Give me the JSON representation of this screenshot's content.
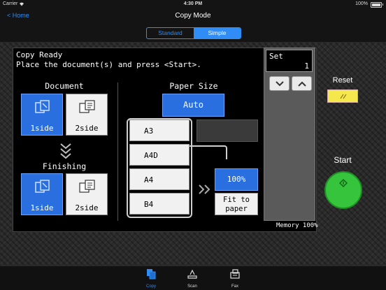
{
  "status_bar": {
    "carrier": "Carrier",
    "time": "4:30 PM",
    "battery": "100%"
  },
  "nav": {
    "back_label": "< Home",
    "title": "Copy Mode"
  },
  "mode_tabs": {
    "standard": "Standard",
    "simple": "Simple",
    "selected": "Simple"
  },
  "panel": {
    "message_line1": "Copy Ready",
    "message_line2": "Place the document(s) and press <Start>.",
    "document": {
      "label": "Document",
      "option1": "1side",
      "option2": "2side",
      "selected": "1side"
    },
    "finishing": {
      "label": "Finishing",
      "option1": "1side",
      "option2": "2side",
      "selected": "1side"
    },
    "paper_size": {
      "label": "Paper Size",
      "auto": "Auto",
      "trays": [
        "A3",
        "A4D",
        "A4",
        "B4"
      ],
      "zoom": "100%",
      "fit": "Fit to paper"
    },
    "memory": "Memory 100%"
  },
  "set": {
    "label": "Set",
    "value": "1"
  },
  "reset": {
    "label": "Reset",
    "color": "#f5e84d"
  },
  "start": {
    "label": "Start",
    "color": "#36c43c"
  },
  "tab_bar": {
    "copy": "Copy",
    "scan": "Scan",
    "fax": "Fax",
    "active": "Copy"
  },
  "colors": {
    "accent": "#2f8df5",
    "selected_blue": "#2a6fe0"
  }
}
